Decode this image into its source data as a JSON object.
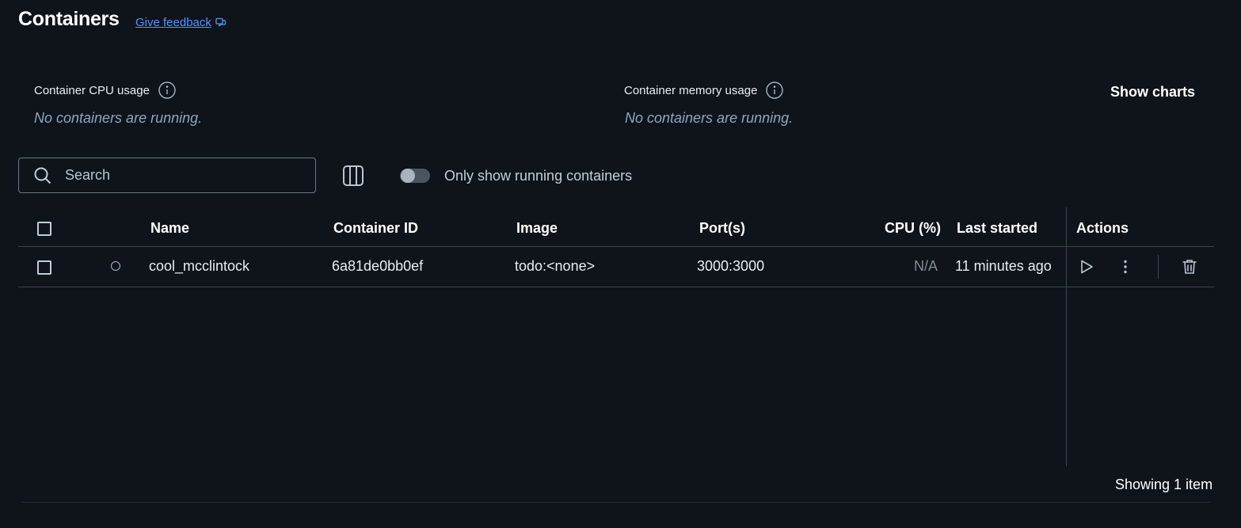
{
  "header": {
    "title": "Containers",
    "feedback_link": "Give feedback"
  },
  "stats": {
    "cpu": {
      "label": "Container CPU usage",
      "empty": "No containers are running."
    },
    "memory": {
      "label": "Container memory usage",
      "empty": "No containers are running."
    },
    "show_charts": "Show charts"
  },
  "toolbar": {
    "search_placeholder": "Search",
    "toggle_label": "Only show running containers",
    "toggle_on": false
  },
  "table": {
    "columns": {
      "name": "Name",
      "container_id": "Container ID",
      "image": "Image",
      "ports": "Port(s)",
      "cpu": "CPU (%)",
      "last_started": "Last started",
      "actions": "Actions"
    },
    "rows": [
      {
        "name": "cool_mcclintock",
        "container_id": "6a81de0bb0ef",
        "image": "todo:<none>",
        "ports": "3000:3000",
        "cpu": "N/A",
        "last_started": "11 minutes ago",
        "status": "stopped"
      }
    ]
  },
  "footer": {
    "count": "Showing 1 item"
  },
  "colors": {
    "background": "#0f141b",
    "link": "#4f96ff",
    "muted_italic": "#8fa6bd"
  }
}
